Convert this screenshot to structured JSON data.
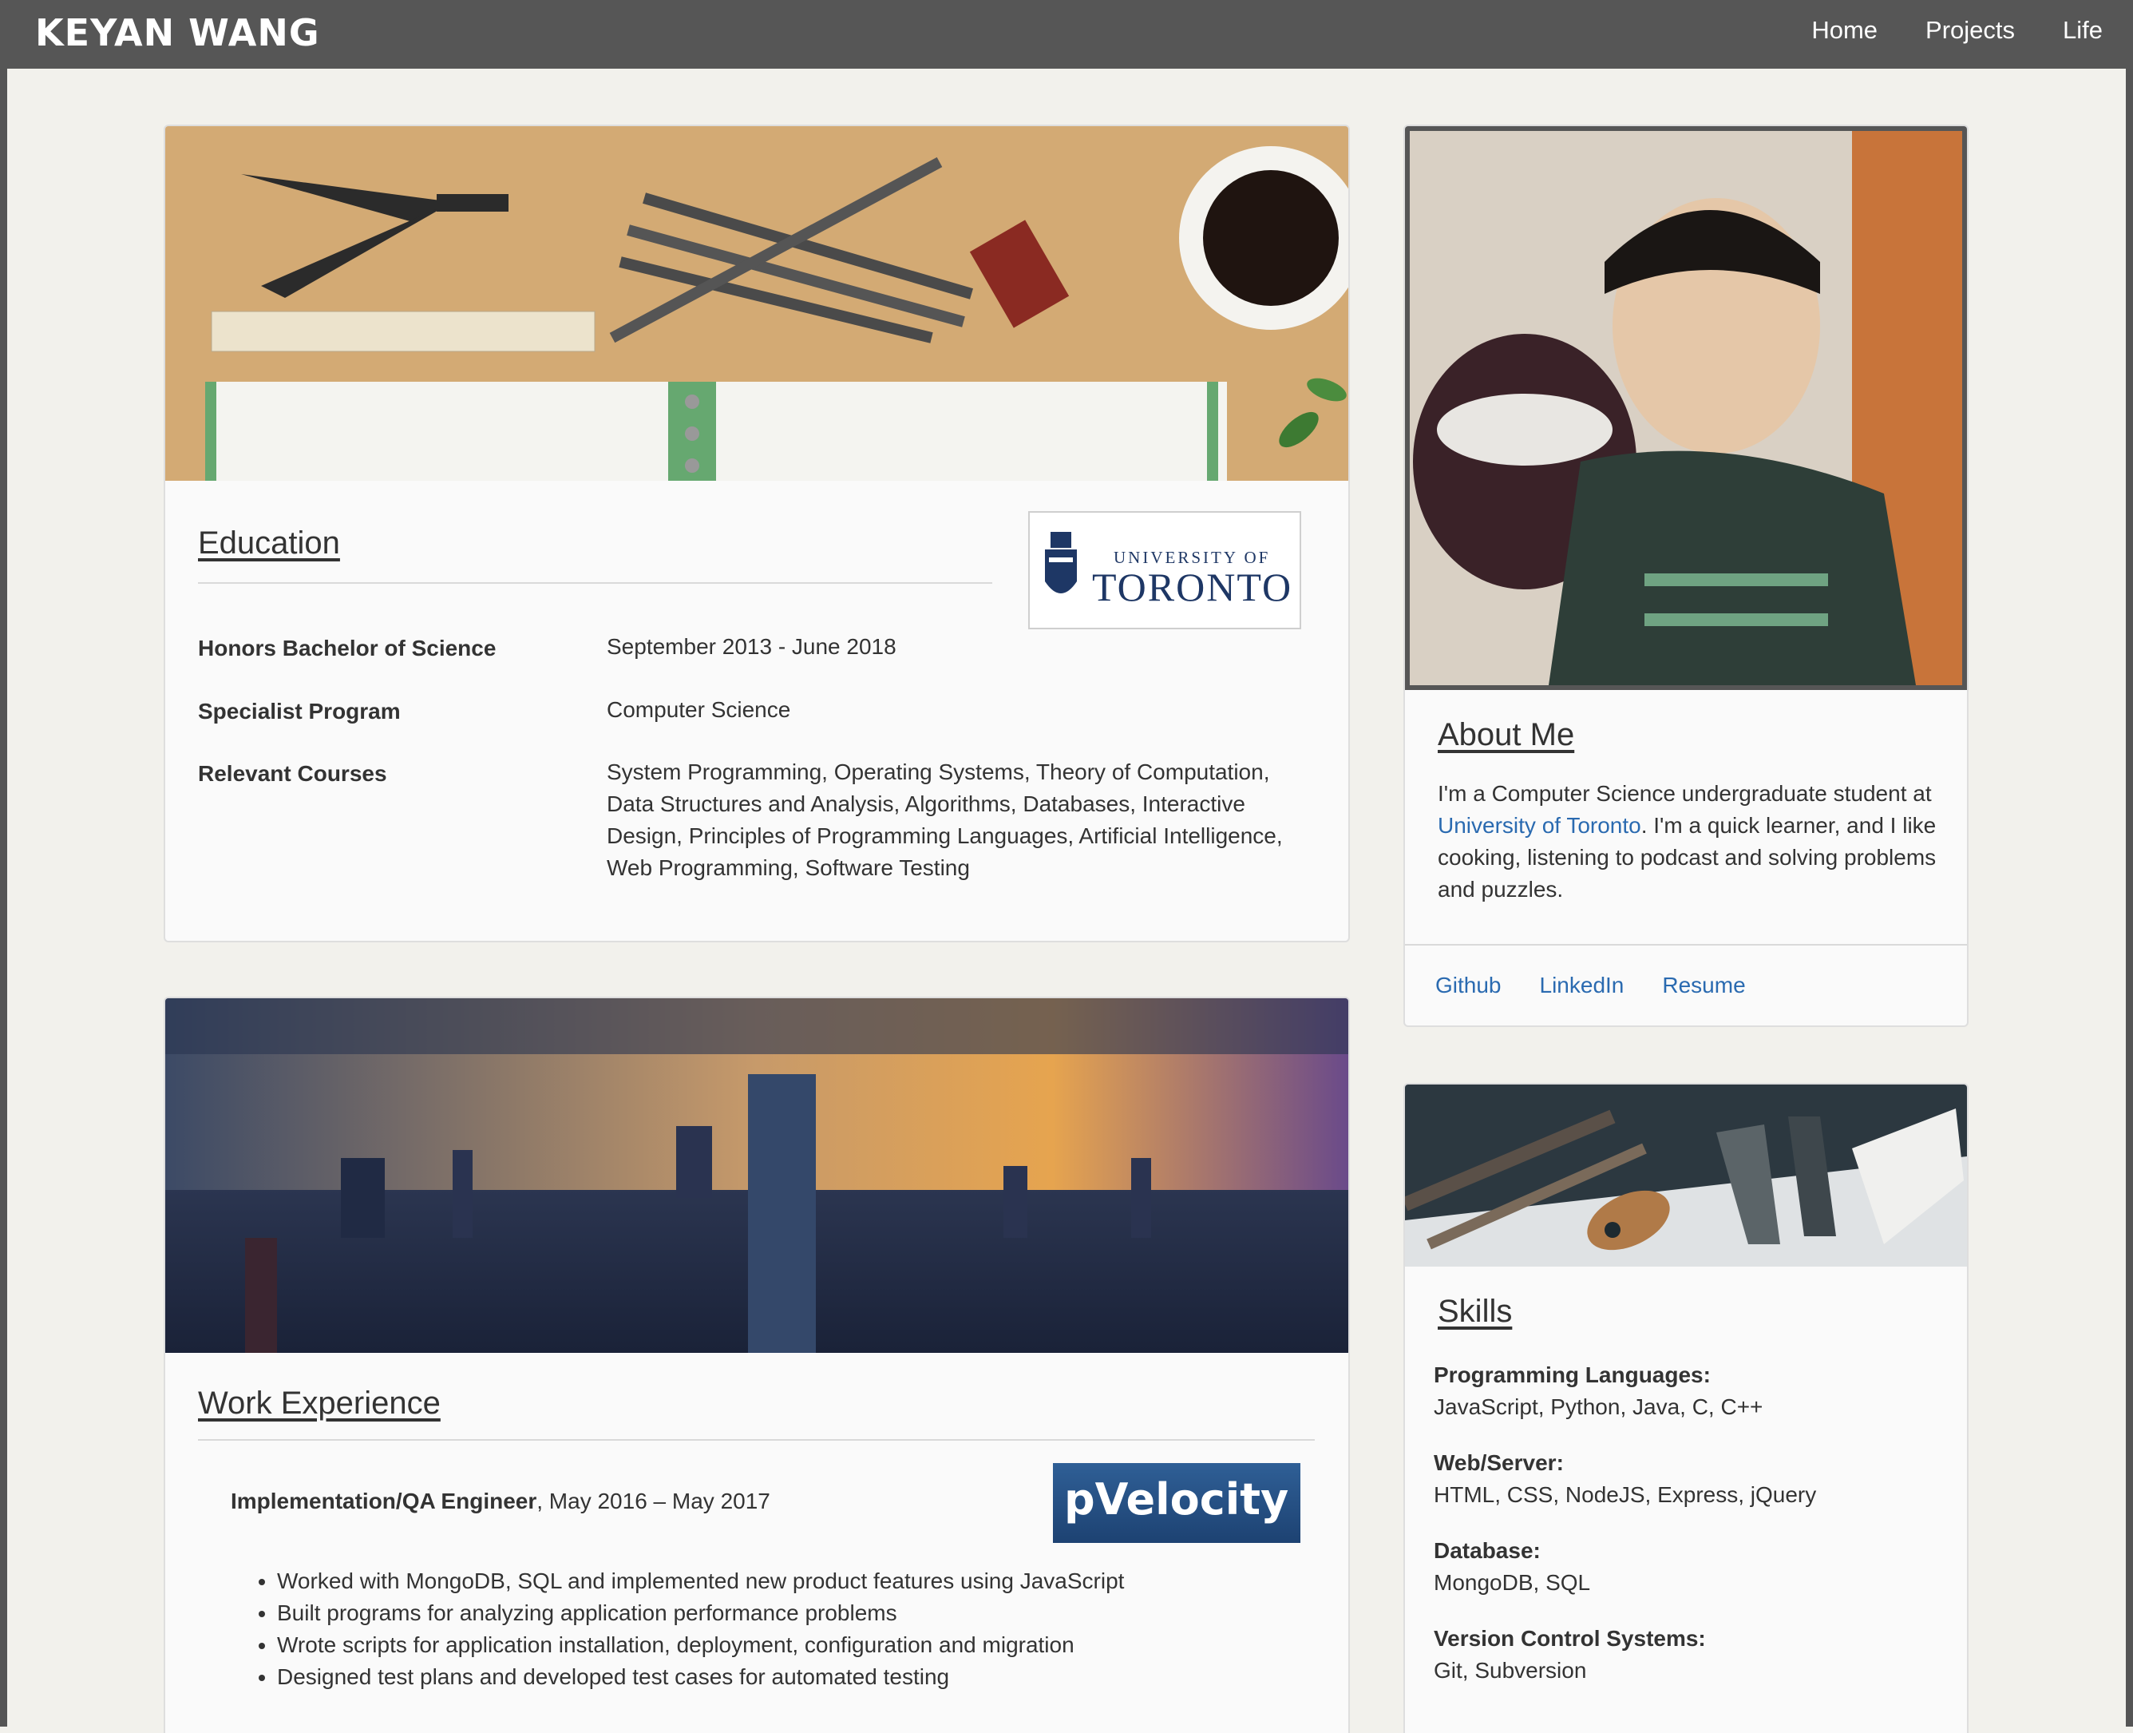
{
  "header": {
    "brand": "KEYAN WANG",
    "nav": [
      "Home",
      "Projects",
      "Life"
    ]
  },
  "education": {
    "heading": "Education",
    "logo_small": "UNIVERSITY OF",
    "logo_big": "TORONTO",
    "rows": [
      {
        "label": "Honors Bachelor of Science",
        "value": "September 2013 - June 2018"
      },
      {
        "label": "Specialist Program",
        "value": "Computer Science"
      },
      {
        "label": "Relevant Courses",
        "lines": [
          "System Programming, Operating Systems, Theory of Computation,",
          "Data Structures and Analysis, Algorithms, Databases, Interactive",
          "Design, Principles of Programming Languages, Artificial Intelligence,",
          "Web Programming, Software Testing"
        ]
      }
    ]
  },
  "work": {
    "heading": "Work Experience",
    "role": "Implementation/QA Engineer",
    "dates": ", May 2016 – May 2017",
    "logo": "pVelocity",
    "bullets": [
      "Worked with MongoDB, SQL and implemented new product features using JavaScript",
      "Built programs for analyzing application performance problems",
      "Wrote scripts for application installation, deployment, configuration and migration",
      "Designed test plans and developed test cases for automated testing"
    ]
  },
  "about": {
    "heading": "About Me",
    "text_before": "I'm a Computer Science undergraduate student at ",
    "link": "University of Toronto",
    "text_after": ". I'm a quick learner, and I like cooking, listening to podcast and solving problems and puzzles.",
    "links": [
      "Github",
      "LinkedIn",
      "Resume"
    ]
  },
  "skills": {
    "heading": "Skills",
    "items": [
      {
        "title": "Programming Languages:",
        "value": "JavaScript, Python, Java, C, C++"
      },
      {
        "title": "Web/Server:",
        "value": "HTML, CSS, NodeJS, Express, jQuery"
      },
      {
        "title": "Database:",
        "value": "MongoDB, SQL"
      },
      {
        "title": "Version Control Systems:",
        "value": "Git, Subversion"
      }
    ]
  },
  "colors": {
    "topbar": "#565656",
    "link": "#2a6ab0",
    "background": "#f2f1ec"
  }
}
